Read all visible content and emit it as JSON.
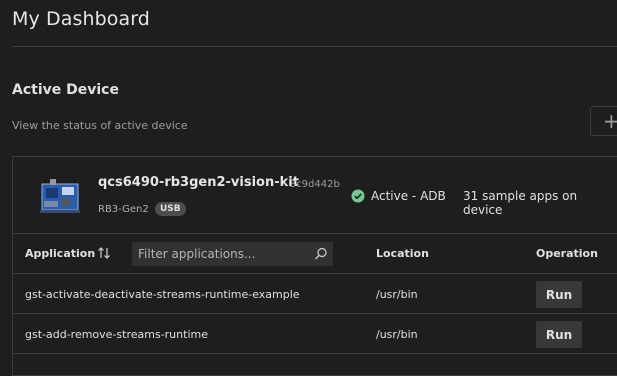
{
  "header": {
    "title": "My Dashboard"
  },
  "section": {
    "title": "Active Device",
    "subtitle": "View the status of active device",
    "add_icon": "plus-icon"
  },
  "device": {
    "name": "qcs6490-rb3gen2-vision-kit",
    "serial": "- 3c9d442b",
    "model": "RB3-Gen2",
    "connection_badge": "USB",
    "status": "Active - ADB",
    "status_color": "#73c991",
    "sample_count": "31 sample apps on device"
  },
  "table": {
    "columns": {
      "application": "Application",
      "location": "Location",
      "operation": "Operation"
    },
    "filter_placeholder": "Filter applications...",
    "rows": [
      {
        "application": "gst-activate-deactivate-streams-runtime-example",
        "location": "/usr/bin",
        "action": "Run"
      },
      {
        "application": "gst-add-remove-streams-runtime",
        "location": "/usr/bin",
        "action": "Run"
      }
    ]
  }
}
